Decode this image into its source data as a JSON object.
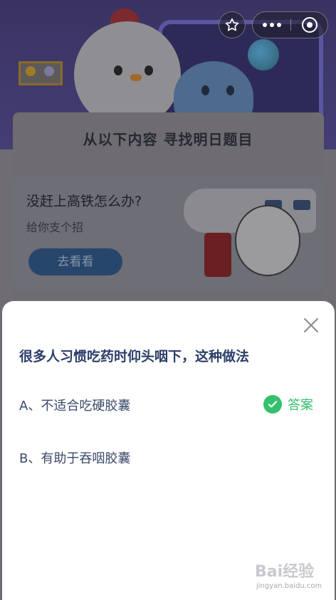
{
  "header": {
    "star_icon": "star-outline-icon",
    "more_icon": "more-dots-icon",
    "close_icon": "close-circle-icon"
  },
  "background": {
    "title": "从以下内容 寻找明日题目",
    "card": {
      "headline": "没赶上高铁怎么办?",
      "subtitle": "给你支个招",
      "button_label": "去看看"
    }
  },
  "sheet": {
    "close_icon": "close-icon",
    "question": "很多人习惯吃药时仰头咽下，这种做法",
    "options": [
      {
        "label": "A、不适合吃硬胶囊",
        "correct": true
      },
      {
        "label": "B、有助于吞咽胶囊",
        "correct": false
      }
    ],
    "answer_label": "答案",
    "answer_icon": "check-circle-icon",
    "answer_color": "#35c06e"
  },
  "watermark": {
    "logo": "Bai经验",
    "url": "jingyan.baidu.com"
  }
}
